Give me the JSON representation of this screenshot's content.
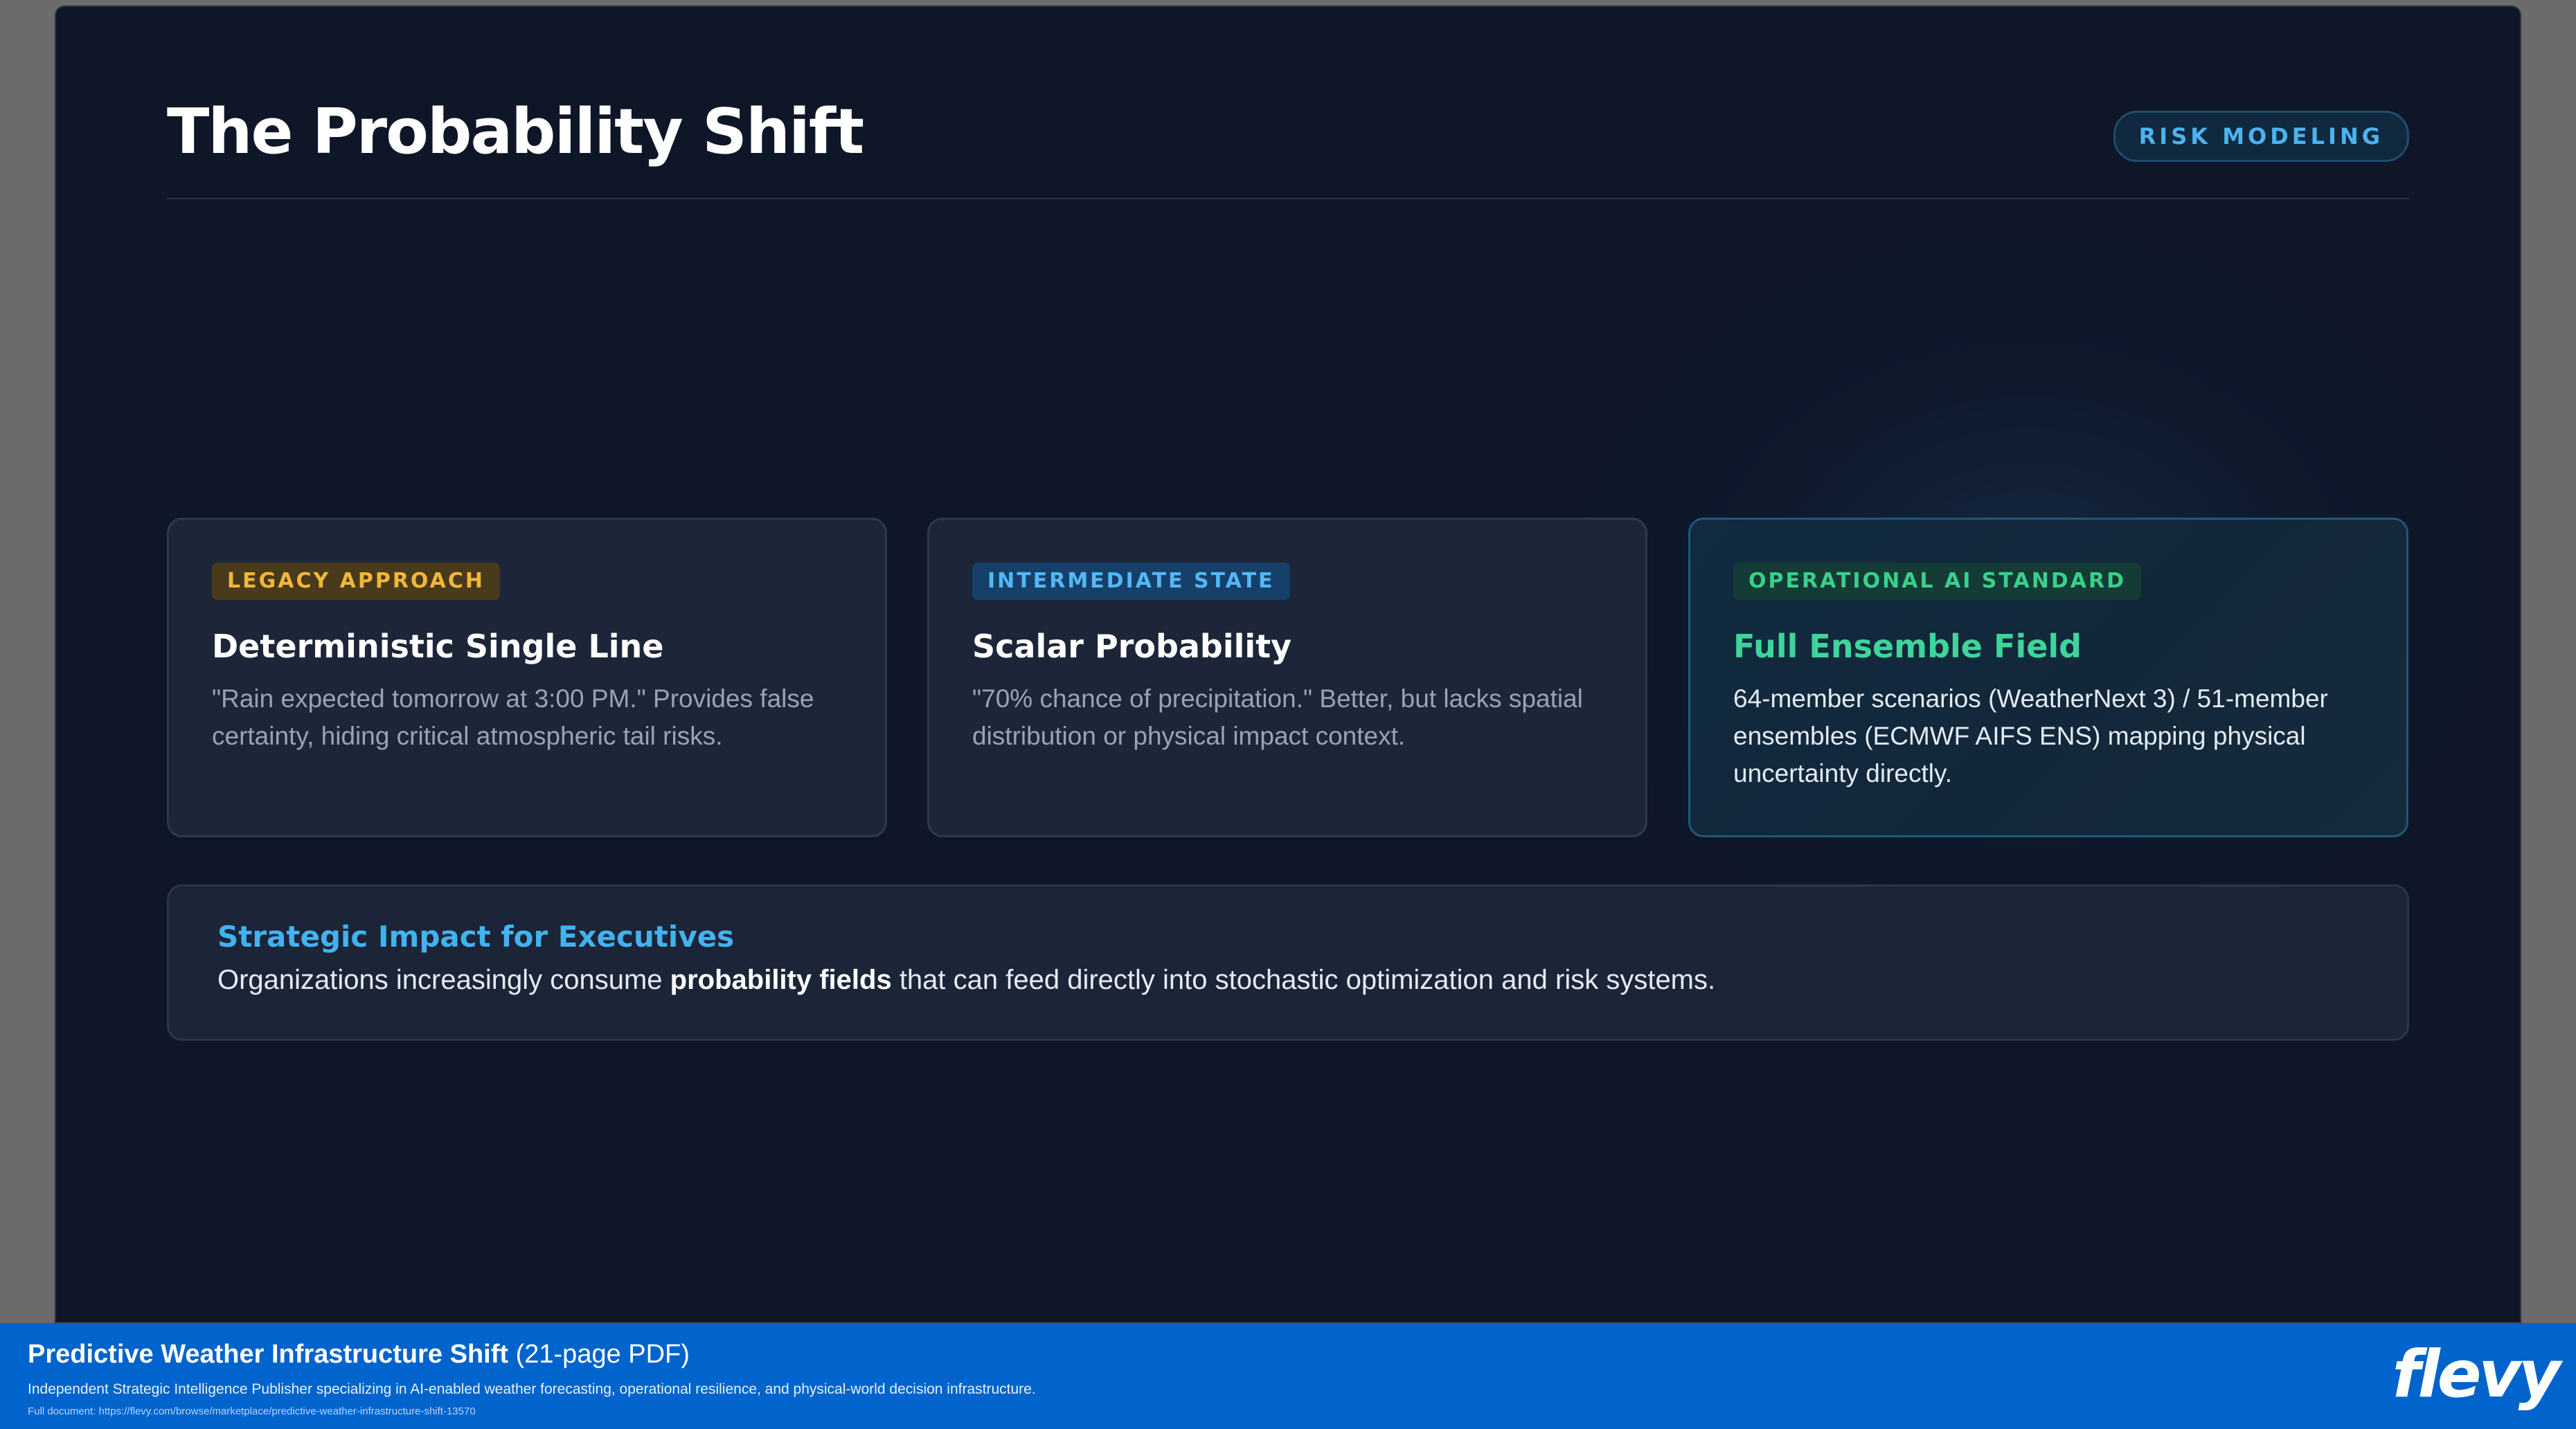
{
  "slide": {
    "title": "The Probability Shift",
    "category_pill": "RISK MODELING"
  },
  "cards": [
    {
      "tag": "LEGACY APPROACH",
      "title": "Deterministic Single Line",
      "body": "\"Rain expected tomorrow at 3:00 PM.\" Provides false certainty, hiding critical atmospheric tail risks."
    },
    {
      "tag": "INTERMEDIATE STATE",
      "title": "Scalar Probability",
      "body": "\"70% chance of precipitation.\" Better, but lacks spatial distribution or physical impact context."
    },
    {
      "tag": "OPERATIONAL AI STANDARD",
      "title": "Full Ensemble Field",
      "body": "64-member scenarios (WeatherNext 3) / 51-member ensembles (ECMWF AIFS ENS) mapping physical uncertainty directly."
    }
  ],
  "impact": {
    "title": "Strategic Impact for Executives",
    "text_before": "Organizations increasingly consume ",
    "text_bold": "probability fields",
    "text_after": " that can feed directly into stochastic optimization and risk systems."
  },
  "footer": {
    "doc_title": "Predictive Weather Infrastructure Shift",
    "doc_pages": " (21-page PDF)",
    "description": "Independent Strategic Intelligence Publisher specializing in AI-enabled weather forecasting, operational resilience, and physical-world decision infrastructure.",
    "link": "Full document: https://flevy.com/browse/marketplace/predictive-weather-infrastructure-shift-13570",
    "logo": "flevy"
  },
  "colors": {
    "slide_bg": "#0e1628",
    "accent_blue": "#43b2ef",
    "legacy_amber": "#f0b73a",
    "ops_green": "#3ed59a",
    "footer_blue": "#0064cc"
  }
}
